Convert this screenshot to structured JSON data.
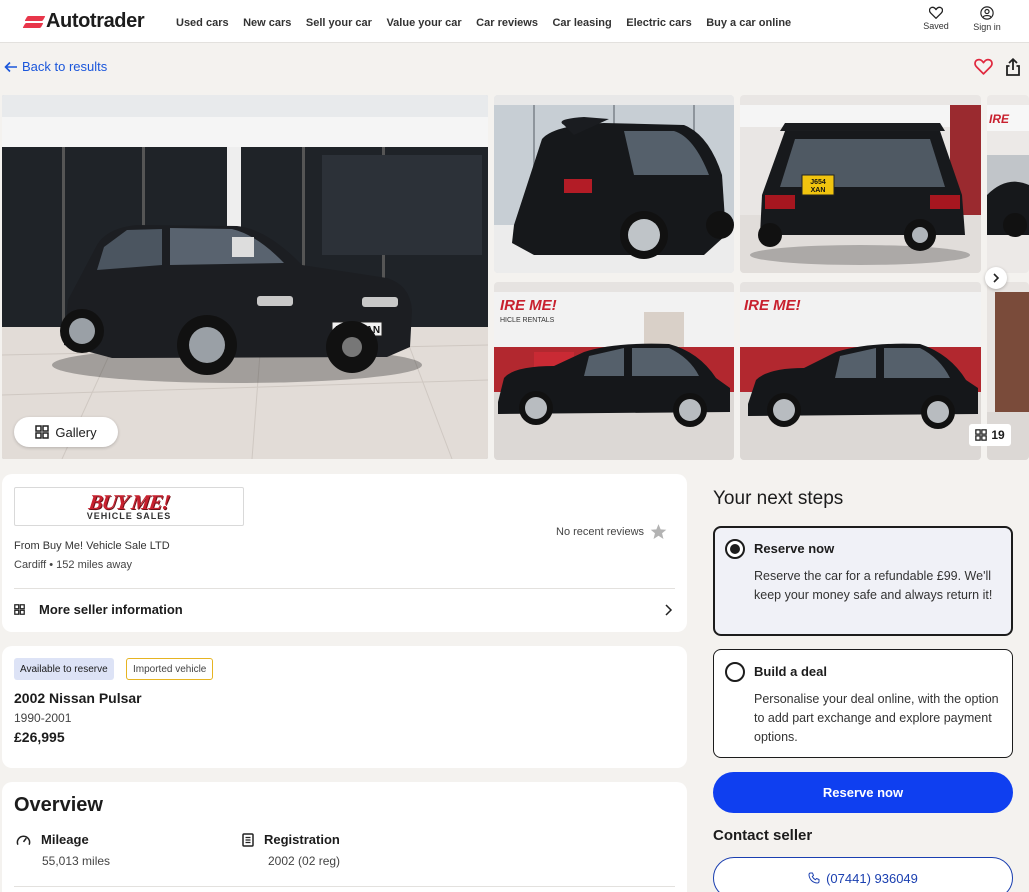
{
  "header": {
    "logo_text": "Autotrader",
    "nav": [
      "Used cars",
      "New cars",
      "Sell your car",
      "Value your car",
      "Car reviews",
      "Car leasing",
      "Electric cars",
      "Buy a car online"
    ],
    "saved_label": "Saved",
    "signin_label": "Sign in"
  },
  "back_label": "Back to results",
  "gallery": {
    "button_label": "Gallery",
    "photo_count": "19",
    "main_plate": "J654 XAN",
    "rear_plate_line1": "J654",
    "rear_plate_line2": "XAN",
    "showroom_sign": "IRE ME!",
    "showroom_sign_sub": "HICLE RENTALS"
  },
  "seller": {
    "logo_big": "BUY ME!",
    "logo_small": "VEHICLE SALES",
    "reviews_text": "No recent reviews",
    "name": "From Buy Me! Vehicle Sale LTD",
    "location": "Cardiff • 152 miles away",
    "more_info_label": "More seller information"
  },
  "vehicle": {
    "badge_reserve": "Available to reserve",
    "badge_import": "Imported vehicle",
    "title": "2002 Nissan Pulsar",
    "years": "1990-2001",
    "price": "£26,995"
  },
  "overview": {
    "title": "Overview",
    "mileage_label": "Mileage",
    "mileage_value": "55,013 miles",
    "registration_label": "Registration",
    "registration_value": "2002 (02 reg)"
  },
  "next_steps": {
    "title": "Your next steps",
    "option1_title": "Reserve now",
    "option1_desc": "Reserve the car for a refundable £99. We'll keep your money safe and always return it!",
    "option2_title": "Build a deal",
    "option2_desc": "Personalise your deal online, with the option to add part exchange and explore payment options.",
    "reserve_button": "Reserve now",
    "contact_title": "Contact seller",
    "phone": "(07441) 936049"
  },
  "colors": {
    "brand_red": "#e8364a",
    "primary_blue": "#0f3ff0",
    "link_blue": "#1a56db"
  }
}
